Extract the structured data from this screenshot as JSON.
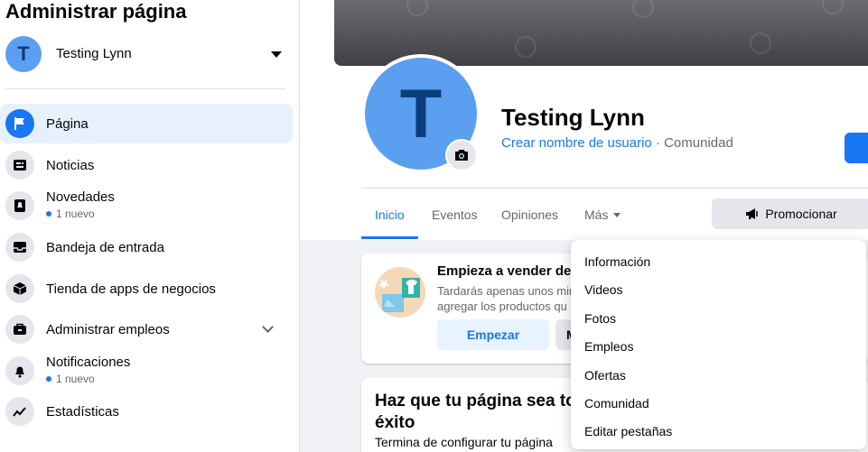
{
  "sidebar": {
    "title": "Administrar página",
    "page_name": "Testing Lynn",
    "avatar_letter": "T",
    "items": [
      {
        "label": "Página",
        "icon": "flag-icon",
        "active": true
      },
      {
        "label": "Noticias",
        "icon": "news-icon"
      },
      {
        "label": "Novedades",
        "icon": "bell-badge-icon",
        "sub": "1 nuevo"
      },
      {
        "label": "Bandeja de entrada",
        "icon": "inbox-icon"
      },
      {
        "label": "Tienda de apps de negocios",
        "icon": "box-icon"
      },
      {
        "label": "Administrar empleos",
        "icon": "briefcase-icon"
      },
      {
        "label": "Notificaciones",
        "icon": "bell-icon",
        "sub": "1 nuevo"
      },
      {
        "label": "Estadísticas",
        "icon": "chart-line-icon"
      }
    ]
  },
  "profile": {
    "avatar_letter": "T",
    "name": "Testing Lynn",
    "username_link": "Crear nombre de usuario",
    "category": " · Comunidad"
  },
  "tabs": [
    {
      "label": "Inicio",
      "active": true
    },
    {
      "label": "Eventos"
    },
    {
      "label": "Opiniones"
    },
    {
      "label": "Más"
    }
  ],
  "promote_label": "Promocionar",
  "shop_card": {
    "title": "Empieza a vender des",
    "line1": "Tardarás apenas unos mir",
    "line2": "agregar los productos qu",
    "start_label": "Empezar",
    "second_label": "M"
  },
  "success_card": {
    "title_line1": "Haz que tu página sea to",
    "title_line2": "éxito",
    "text": "Termina de configurar tu página"
  },
  "dropdown": {
    "items": [
      "Información",
      "Videos",
      "Fotos",
      "Empleos",
      "Ofertas",
      "Comunidad",
      "Editar pestañas"
    ]
  },
  "colors": {
    "accent": "#1877f2",
    "avatar": "#5b9ff0",
    "active_bg": "#e7f0fd"
  }
}
